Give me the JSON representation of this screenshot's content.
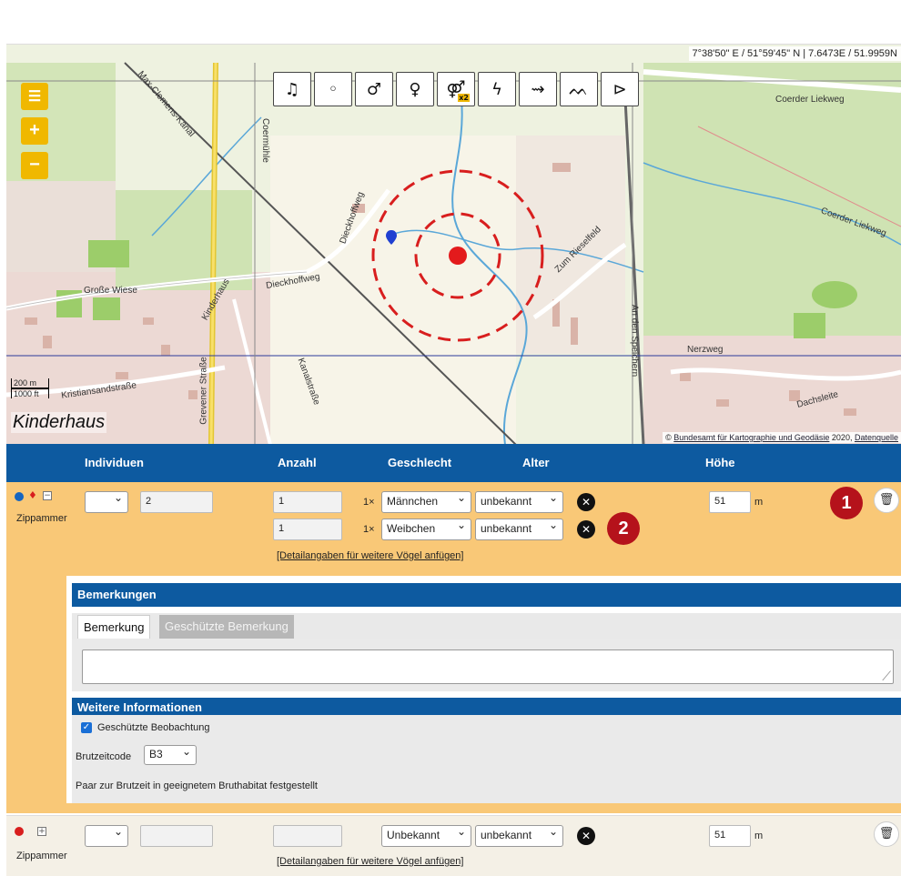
{
  "map": {
    "coords": "7°38'50\" E / 51°59'45\" N | 7.6473E / 51.9959N",
    "zoom_in": "+",
    "zoom_out": "−",
    "town_label": "Kinderhaus",
    "scale_m": "200 m",
    "scale_ft": "1000 ft",
    "attribution_prefix": "© ",
    "attribution_link1": "Bundesamt für Kartographie und Geodäsie",
    "attribution_mid": " 2020, ",
    "attribution_link2": "Datenquelle",
    "labels": {
      "coerder_liekweg_1": "Coerder Liekweg",
      "coerder_liekweg_2": "Coerder Liekweg",
      "dieckhoffweg_1": "Dieckhoffweg",
      "dieckhoffweg_2": "Dieckhoffweg",
      "zum_rieselfeld": "Zum Rieselfeld",
      "an_den_speichern": "An den Speichern",
      "grosse_wiese": "Große Wiese",
      "kinderhaus_str": "Kinderhaus",
      "grevener_strasse": "Grevener Straße",
      "kanalstrasse": "Kanalstraße",
      "kristiansandstrasse": "Kristiansandstraße",
      "nerzweg": "Nerzweg",
      "dachsleite": "Dachsleite",
      "coermuehle": "Coermühle",
      "max_clemens_kanal": "Max-Clemens-Kanal"
    },
    "tools": [
      {
        "name": "song-tool-button",
        "glyph": "♫"
      },
      {
        "name": "individual-tool-button",
        "glyph": "◦"
      },
      {
        "name": "male-tool-button",
        "glyph": "♂"
      },
      {
        "name": "female-tool-button",
        "glyph": "♀"
      },
      {
        "name": "pair-tool-button",
        "glyph": "⚤"
      },
      {
        "name": "conflict-tool-button",
        "glyph": "ϟ"
      },
      {
        "name": "flying-tool-button",
        "glyph": "⇝"
      },
      {
        "name": "group-tool-button",
        "glyph": "ᨓ"
      },
      {
        "name": "flyover-tool-button",
        "glyph": "⊳"
      }
    ],
    "pair_badge": "x2"
  },
  "table": {
    "headers": {
      "individuals": "Individuen",
      "count": "Anzahl",
      "sex": "Geschlecht",
      "age": "Alter",
      "height": "Höhe"
    },
    "row1": {
      "species": "Zippammer",
      "individuals_value": "2",
      "entries": [
        {
          "count": "1",
          "mult": "1×",
          "sex": "Männchen",
          "age": "unbekannt"
        },
        {
          "count": "1",
          "mult": "1×",
          "sex": "Weibchen",
          "age": "unbekannt"
        }
      ],
      "add_detail_link": "[Detailangaben für weitere Vögel anfügen]",
      "height_value": "51",
      "height_unit": "m",
      "badge1": "1",
      "badge2": "2",
      "remarks": {
        "title": "Bemerkungen",
        "tab_active": "Bemerkung",
        "tab_inactive": "Geschützte Bemerkung",
        "text": ""
      },
      "further_info": {
        "title": "Weitere Informationen",
        "protected_label": "Geschützte Beobachtung",
        "breeding_code_label": "Brutzeitcode",
        "breeding_code_value": "B3",
        "breeding_code_desc": "Paar zur Brutzeit in geeignetem Bruthabitat festgestellt"
      }
    },
    "row2": {
      "species": "Zippammer",
      "sex": "Unbekannt",
      "age": "unbekannt",
      "add_detail_link": "[Detailangaben für weitere Vögel anfügen]",
      "height_value": "51",
      "height_unit": "m"
    }
  },
  "colors": {
    "header_blue": "#0d5aa0",
    "row_orange": "#f9c877",
    "map_ctrl_yellow": "#f0b800",
    "marker_red": "#e31a1c",
    "badge_red": "#b5121b"
  }
}
